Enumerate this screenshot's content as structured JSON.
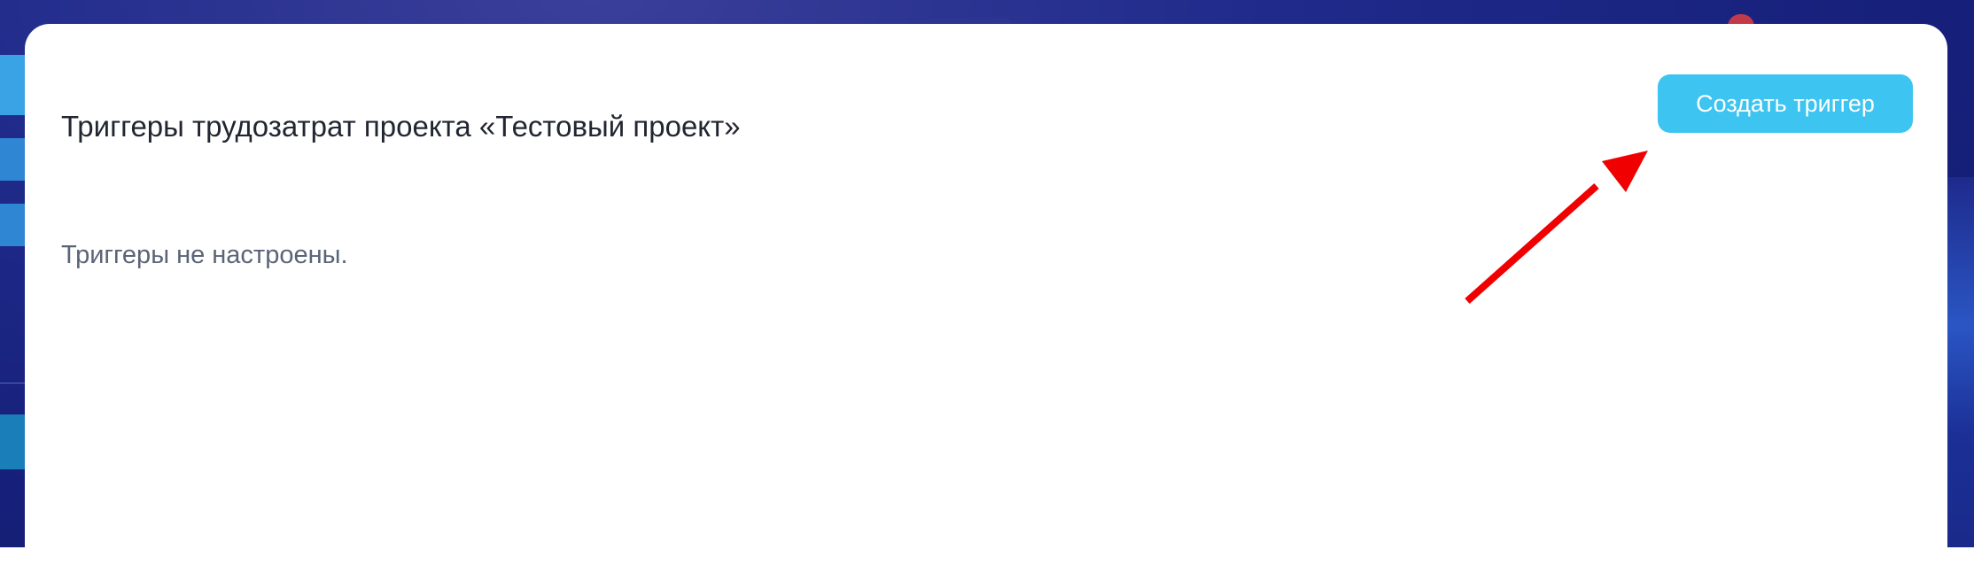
{
  "modal": {
    "title": "Триггеры трудозатрат проекта «Тестовый проект»",
    "create_button_label": "Создать триггер",
    "empty_state": "Триггеры не настроены."
  },
  "colors": {
    "accent": "#3dc4f0",
    "annotation_arrow": "#f00000",
    "backdrop": "#1f2a8a",
    "title_text": "#222631",
    "muted_text": "#5b6478"
  },
  "icons": {
    "annotation": "arrow-pointer-icon"
  }
}
